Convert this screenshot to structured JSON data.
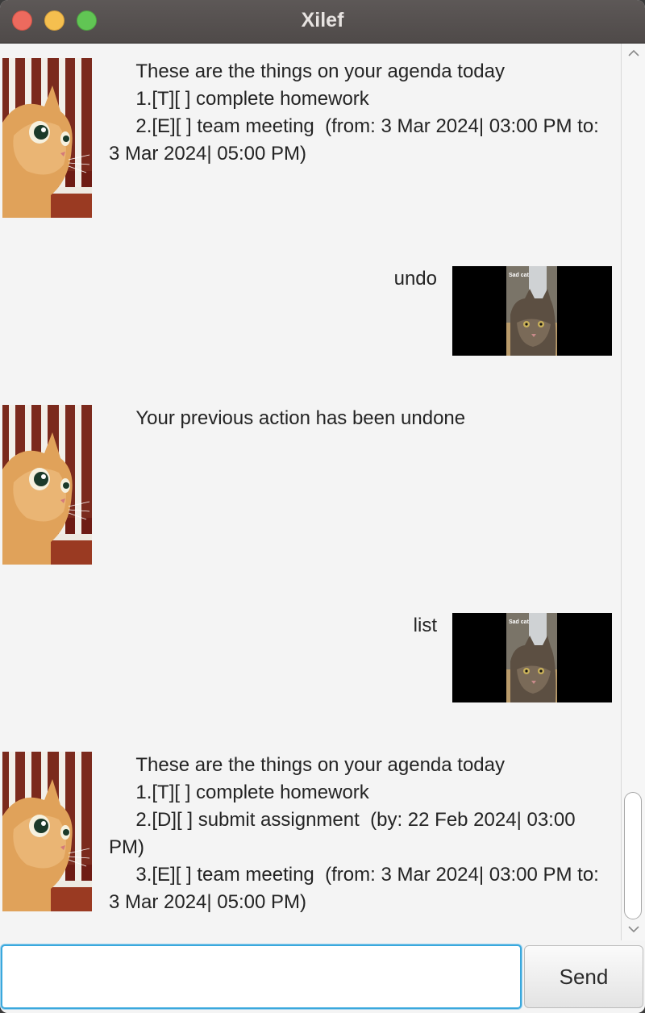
{
  "window": {
    "title": "Xilef"
  },
  "messages": [
    {
      "sender": "bot",
      "text": "\tThese are the things on your agenda today\n\t1.[T][ ] complete homework\n\t2.[E][ ] team meeting  (from: 3 Mar 2024| 03:00 PM to: 3 Mar 2024| 05:00 PM)"
    },
    {
      "sender": "user",
      "text": "undo",
      "avatar_caption": "Sad cat"
    },
    {
      "sender": "bot",
      "text": "\tYour previous action has been undone"
    },
    {
      "sender": "user",
      "text": "list",
      "avatar_caption": "Sad cat"
    },
    {
      "sender": "bot",
      "text": "\tThese are the things on your agenda today\n\t1.[T][ ] complete homework\n\t2.[D][ ] submit assignment  (by: 22 Feb 2024| 03:00 PM)\n\t3.[E][ ] team meeting  (from: 3 Mar 2024| 03:00 PM to: 3 Mar 2024| 05:00 PM)"
    }
  ],
  "input": {
    "value": "",
    "placeholder": ""
  },
  "send_button": {
    "label": "Send"
  },
  "icons": {
    "scroll_up": "chevron-up-icon",
    "scroll_down": "chevron-down-icon"
  },
  "colors": {
    "titlebar": "#57524f",
    "close": "#ed6a5e",
    "minimize": "#f5bf4f",
    "maximize": "#61c554",
    "input_focus": "#3aa8dd",
    "chat_bg": "#f4f4f4"
  }
}
